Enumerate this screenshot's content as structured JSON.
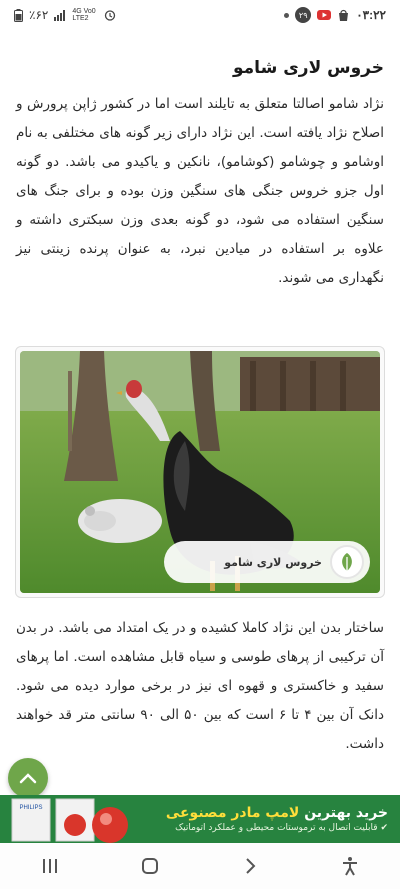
{
  "status_bar": {
    "time": "۰۳:۲۲",
    "notif_badge": "۲۹",
    "battery": "٪۶۲",
    "network": "4G Vo0 LTE2"
  },
  "article": {
    "title": "خروس لاری شامو",
    "paragraph1": "نژاد شامو اصالتا متعلق به تایلند است اما در کشور ژاپن پرورش و اصلاح نژاد یافته است. این نژاد دارای زیر گونه های مختلفی به نام اوشامو و چوشامو (کوشامو)، نانکین و یاکیدو می باشد. دو گونه اول جزو خروس جنگی های سنگین وزن بوده و برای جنگ های سنگین استفاده می شود، دو گونه بعدی وزن سبکتری داشته و علاوه بر استفاده در میادین نبرد، به عنوان پرنده زینتی نیز نگهداری می شوند.",
    "image_caption": "خروس لاری شامو",
    "paragraph2": "ساختار بدن این نژاد کاملا کشیده و در یک امتداد می باشد. در بدن آن ترکیبی از پرهای طوسی و سیاه قابل مشاهده است. اما پرهای سفید و خاکستری و قهوه ای نیز در برخی موارد دیده می شود. دانک آن بین ۴ تا ۶ است که بین ۵۰ الی ۹۰ سانتی متر قد خواهند داشت."
  },
  "ad": {
    "title_prefix": "خرید بهترین",
    "title_highlight": "لامپ مادر مصنوعی",
    "subtitle": "قابلیت اتصال به ترموستات محیطی و عملکرد اتوماتیک",
    "brand": "PHILIPS"
  },
  "colors": {
    "ad_green": "#27833f",
    "fab_green": "#6fa64a",
    "highlight_yellow": "#ffde3b"
  }
}
